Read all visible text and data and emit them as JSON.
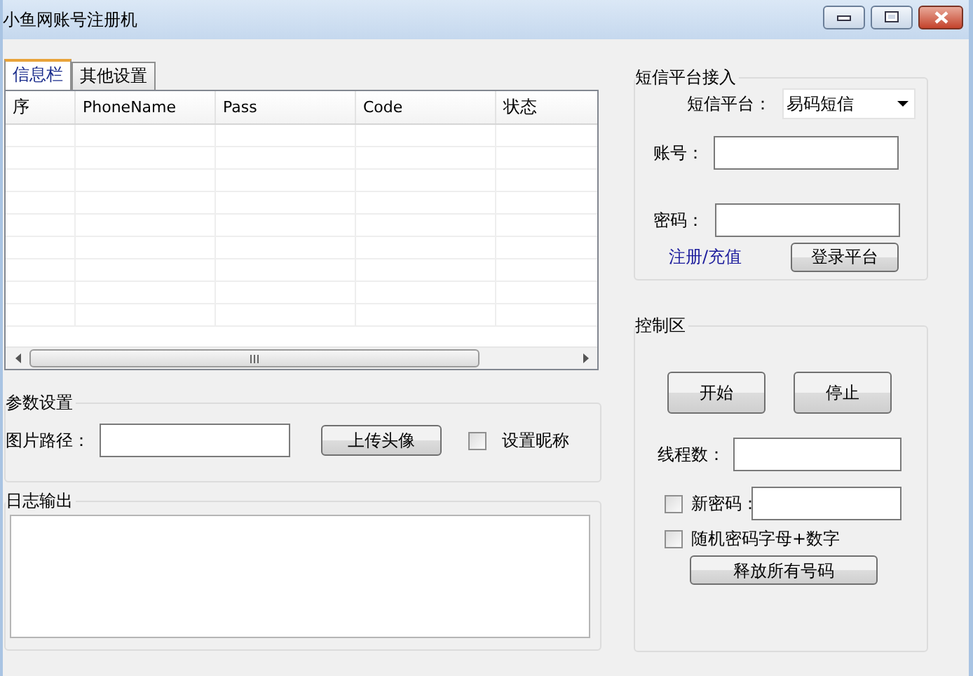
{
  "window": {
    "title": "小鱼网账号注册机"
  },
  "tabs": [
    {
      "label": "信息栏",
      "selected": true
    },
    {
      "label": "其他设置",
      "selected": false
    }
  ],
  "table": {
    "columns": [
      "序",
      "PhoneName",
      "Pass",
      "Code",
      "状态"
    ]
  },
  "params_group": {
    "title": "参数设置",
    "image_path_label": "图片路径：",
    "upload_button": "上传头像",
    "nickname_checkbox": {
      "label": "设置昵称",
      "checked": false
    }
  },
  "log_group": {
    "title": "日志输出"
  },
  "sms_group": {
    "title": "短信平台接入",
    "platform_label": "短信平台：",
    "platform_value": "易码短信",
    "account_label": "账号：",
    "password_label": "密码：",
    "register_link": "注册/充值",
    "login_button": "登录平台"
  },
  "control_group": {
    "title": "控制区",
    "start_button": "开始",
    "stop_button": "停止",
    "threads_label": "线程数：",
    "new_password": {
      "label": "新密码：",
      "checked": false
    },
    "random_password": {
      "label": "随机密码字母+数字",
      "checked": false
    },
    "release_button": "释放所有号码"
  }
}
